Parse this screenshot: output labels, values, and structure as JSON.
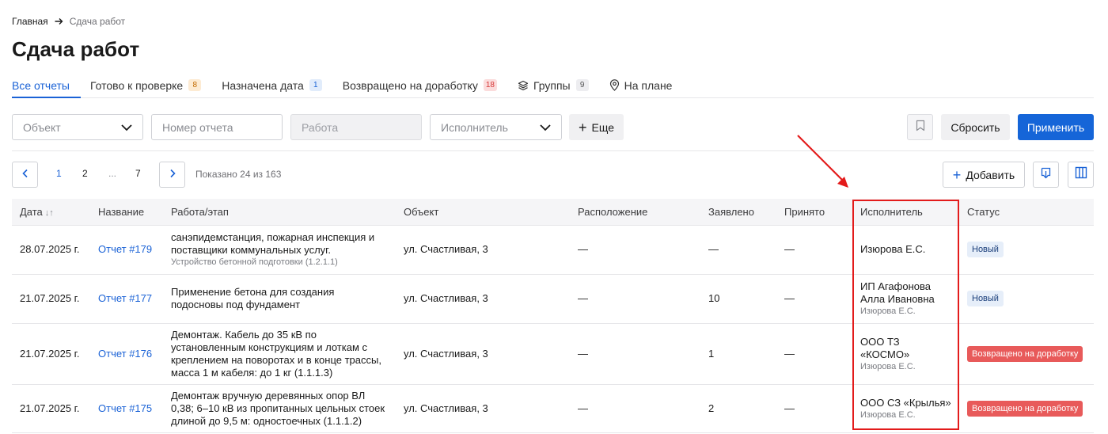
{
  "breadcrumb": {
    "home": "Главная",
    "current": "Сдача работ"
  },
  "page": {
    "title": "Сдача работ"
  },
  "tabs": [
    {
      "label": "Все отчеты",
      "badge": "",
      "active": true
    },
    {
      "label": "Готово к проверке",
      "badge": "8",
      "badge_color": "orange"
    },
    {
      "label": "Назначена дата",
      "badge": "1",
      "badge_color": "blue"
    },
    {
      "label": "Возвращено на доработку",
      "badge": "18",
      "badge_color": "red"
    },
    {
      "label": "Группы",
      "badge": "9",
      "badge_color": "gray",
      "icon": "layers-icon"
    },
    {
      "label": "На плане",
      "badge": "",
      "icon": "map-pin-icon"
    }
  ],
  "filters": {
    "object_placeholder": "Объект",
    "report_number_placeholder": "Номер отчета",
    "work_placeholder": "Работа",
    "executor_placeholder": "Исполнитель",
    "more_label": "Еще",
    "reset_label": "Сбросить",
    "apply_label": "Применить"
  },
  "pagination": {
    "pages": [
      "1",
      "2",
      "...",
      "7"
    ],
    "current": "1",
    "info": "Показано 24 из 163"
  },
  "actions": {
    "add_label": "Добавить"
  },
  "table": {
    "columns": {
      "date": "Дата",
      "name": "Название",
      "work": "Работа/этап",
      "object": "Объект",
      "location": "Расположение",
      "declared": "Заявлено",
      "accepted": "Принято",
      "executor": "Исполнитель",
      "status": "Статус"
    },
    "rows": [
      {
        "date": "28.07.2025 г.",
        "name": "Отчет #179",
        "work": "санэпидемстанция, пожарная инспекция и поставщики коммунальных услуг.",
        "work_sub": "Устройство бетонной подготовки (1.2.1.1)",
        "object": "ул. Счастливая, 3",
        "location": "—",
        "declared": "—",
        "accepted": "—",
        "executor": "Изюрова Е.С.",
        "executor_sub": "",
        "status": "Новый",
        "status_type": "new"
      },
      {
        "date": "21.07.2025 г.",
        "name": "Отчет #177",
        "work": "Применение бетона для создания подосновы под фундамент",
        "work_sub": "",
        "object": "ул. Счастливая, 3",
        "location": "—",
        "declared": "10",
        "accepted": "—",
        "executor": "ИП Агафонова Алла Ивановна",
        "executor_sub": "Изюрова Е.С.",
        "status": "Новый",
        "status_type": "new"
      },
      {
        "date": "21.07.2025 г.",
        "name": "Отчет #176",
        "work": "Демонтаж. Кабель до 35 кВ по установленным конструкциям и лоткам с креплением на поворотах и в конце трассы, масса 1 м кабеля: до 1 кг (1.1.1.3)",
        "work_sub": "",
        "object": "ул. Счастливая, 3",
        "location": "—",
        "declared": "1",
        "accepted": "—",
        "executor": "ООО ТЗ «КОСМО»",
        "executor_sub": "Изюрова Е.С.",
        "status": "Возвращено на доработку",
        "status_type": "returned"
      },
      {
        "date": "21.07.2025 г.",
        "name": "Отчет #175",
        "work": "Демонтаж вручную деревянных опор ВЛ 0,38; 6–10 кВ из пропитанных цельных стоек длиной до 9,5 м: одностоечных (1.1.1.2)",
        "work_sub": "",
        "object": "ул. Счастливая, 3",
        "location": "—",
        "declared": "2",
        "accepted": "—",
        "executor": "ООО СЗ «Крылья»",
        "executor_sub": "Изюрова Е.С.",
        "status": "Возвращено на доработку",
        "status_type": "returned"
      }
    ]
  },
  "colors": {
    "accent": "#1565d8",
    "annotation": "#e31b1b",
    "status_returned": "#e85a5a",
    "status_new_bg": "#e6eef9"
  }
}
